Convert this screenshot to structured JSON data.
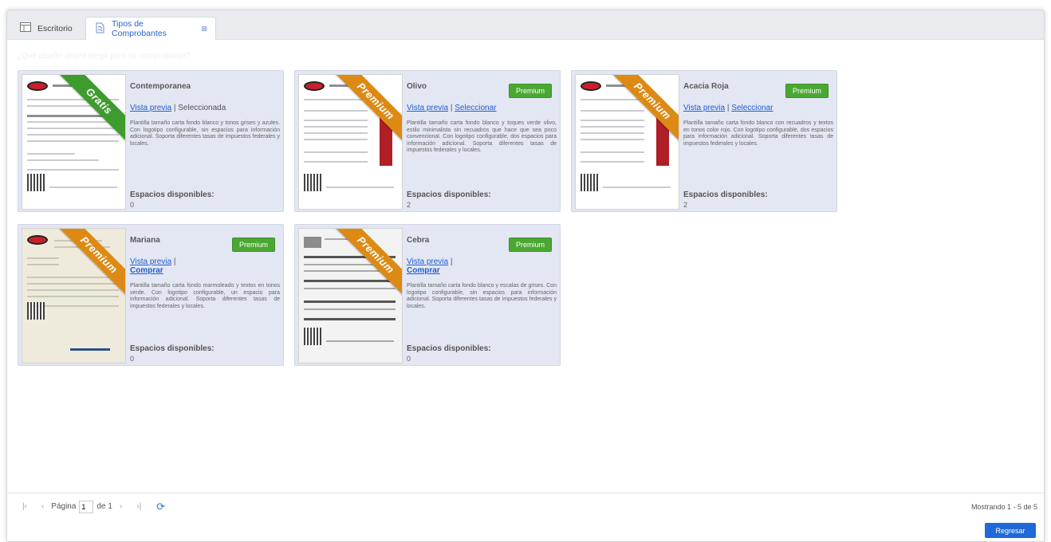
{
  "tabs": [
    {
      "label": "Escritorio",
      "icon": "desktop-icon",
      "active": false
    },
    {
      "label": "Tipos de Comprobantes",
      "icon": "invoice-types-icon",
      "active": true,
      "close_glyph": "⊠"
    }
  ],
  "prompt": "¿Qué diseño desea elegir para su comprobante?",
  "cards": [
    {
      "title": "Contemporanea",
      "ribbon": "Gratis",
      "ribbon_color": "#3e9b2d",
      "badge": "",
      "preview": "Vista previa",
      "separator": " | ",
      "action": "Seleccionada",
      "action_is_link": false,
      "description": "Plantilla tamaño carta fondo blanco y tonos grises y azules. Con logotipo configurable, sin espacios para información adicional. Soporta diferentes tasas de impuestos federales y locales.",
      "spaces_label": "Espacios disponibles:",
      "spaces": "0"
    },
    {
      "title": "Olivo",
      "ribbon": "Premium",
      "ribbon_color": "#dd8a14",
      "badge": "Premium",
      "preview": "Vista previa",
      "separator": " | ",
      "action": "Seleccionar",
      "action_is_link": true,
      "description": "Plantilla tamaño carta fondo blanco y toques verde olivo, estilo minimalista sin recuadros que hace que sea poco convencional. Con logotipo configurable, dos espacios para información adicional. Soporta diferentes tasas de impuestos federales y locales.",
      "spaces_label": "Espacios disponibles:",
      "spaces": "2"
    },
    {
      "title": "Acacia Roja",
      "ribbon": "Premium",
      "ribbon_color": "#dd8a14",
      "badge": "Premium",
      "preview": "Vista previa",
      "separator": " | ",
      "action": "Seleccionar",
      "action_is_link": true,
      "description": "Plantilla tamaño carta fondo blanco con recuadros y textos en tonos color rojo. Con logotipo configurable, dos espacios para información adicional. Soporta diferentes tasas de impuestos federales y locales.",
      "spaces_label": "Espacios disponibles:",
      "spaces": "2"
    },
    {
      "title": "Mariana",
      "ribbon": "Premium",
      "ribbon_color": "#dd8a14",
      "badge": "Premium",
      "preview": "Vista previa",
      "separator": " |",
      "action": "Comprar",
      "action_is_link": true,
      "description": "Plantilla tamaño carta fondo marmoleado y textos en tonos verde. Con logotipo configurable, un espacio para información adicional. Soporta diferentes tasas de impuestos federales y locales.",
      "spaces_label": "Espacios disponibles:",
      "spaces": "0"
    },
    {
      "title": "Cebra",
      "ribbon": "Premium",
      "ribbon_color": "#dd8a14",
      "badge": "Premium",
      "preview": "Vista previa",
      "separator": " |",
      "action": "Comprar",
      "action_is_link": true,
      "description": "Plantilla tamaño carta fondo blanco y escalas de grises. Con logotipo configurable, sin espacios para información adicional. Soporta diferentes tasas de impuestos federales y locales.",
      "spaces_label": "Espacios disponibles:",
      "spaces": "0"
    }
  ],
  "pager": {
    "first": "|‹",
    "prev": "‹",
    "page_label": "Página",
    "page_value": "1",
    "of_label": "de 1",
    "next": "›",
    "last": "›|",
    "refresh_icon": "refresh-icon",
    "showing": "Mostrando 1 - 5 de 5"
  },
  "back_button": "Regresar",
  "colors": {
    "accent": "#1f6ad8",
    "link": "#1f5fcc",
    "premium_badge": "#4aa832",
    "card_bg": "#e3e6f3"
  }
}
